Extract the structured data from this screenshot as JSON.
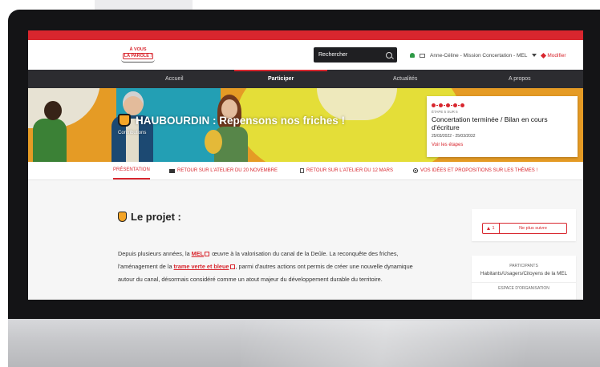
{
  "header": {
    "logo_line1": "À VOUS",
    "logo_line2": "LA PAROLE !",
    "search_placeholder": "Rechercher",
    "user_name": "Anne-Céline - Mission Concertation - MEL",
    "edit_label": "Modifier"
  },
  "nav": {
    "items": [
      {
        "label": "Accueil"
      },
      {
        "label": "Participer"
      },
      {
        "label": "Actualités"
      },
      {
        "label": "A propos"
      }
    ],
    "active": "Participer"
  },
  "hero": {
    "title": "HAUBOURDIN : Repensons nos friches !",
    "subtitle": "Contributions"
  },
  "status": {
    "step": "ÉTAPE 5 SUR 5",
    "title": "Concertation terminée / Bilan en cours d'écriture",
    "dates": "25/03/2022 - 25/03/2032",
    "link": "Voir les étapes"
  },
  "tabs": [
    {
      "label": "PRÉSENTATION"
    },
    {
      "label": "RETOUR SUR L'ATELIER DU 20 NOVEMBRE"
    },
    {
      "label": "RETOUR SUR L'ATELIER DU 12 MARS"
    },
    {
      "label": "VOS IDÉES ET PROPOSITIONS SUR LES THÈMES !"
    }
  ],
  "article": {
    "section_title": "Le projet :",
    "para_part1": "Depuis plusieurs années, la ",
    "link_mel": "MEL",
    "para_part2": " œuvre à la valorisation du canal de la Deûle. La reconquête des friches, l'aménagement de la ",
    "link_trame": "trame verte et bleue",
    "para_part3": ", parmi d'autres actions ont permis de créer une nouvelle dynamique autour du canal, désormais considéré comme un atout majeur du développement durable du territoire."
  },
  "sidebar": {
    "follow_count": "1",
    "follow_label": "Ne plus suivre",
    "participants_label": "PARTICIPANTS",
    "participants_value": "Habitants/Usagers/Citoyens de la MEL",
    "organisation_label": "ESPACE D'ORGANISATION"
  },
  "colors": {
    "accent": "#d8262e",
    "nav_bg": "#2c2c30",
    "hero_orange": "#f4a528",
    "hero_yellow": "#f3ec3c"
  }
}
